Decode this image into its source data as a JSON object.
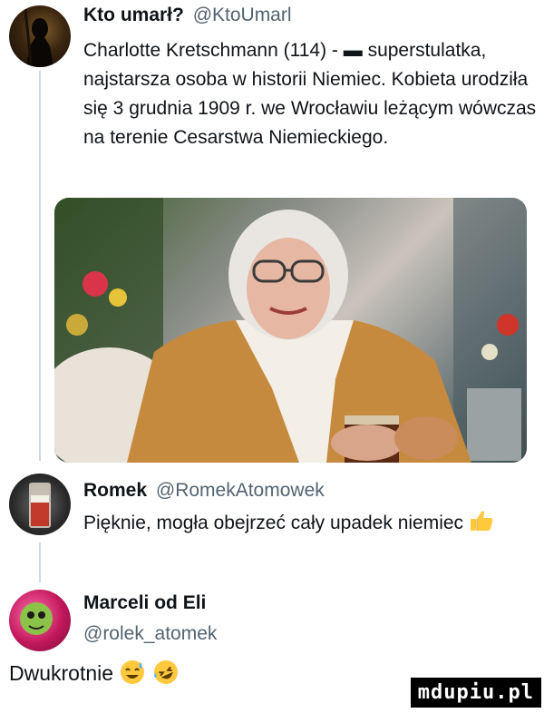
{
  "tweets": [
    {
      "name": "Kto umarł?",
      "handle": "@KtoUmarl",
      "text": "Charlotte Kretschmann (114) - ▬ superstulatka, najstarsza osoba w historii Niemiec. Kobieta urodziła się 3 grudnia 1909 r. we Wrocławiu leżącym wówczas na terenie Cesarstwa Niemieckiego.",
      "flag_colors": [
        "#000000",
        "#dd0000",
        "#ffce00"
      ]
    },
    {
      "name": "Romek",
      "handle": "@RomekAtomowek",
      "text": "Pięknie, mogła obejrzeć cały upadek niemiec",
      "emoji_icon": "thumbs-up-icon"
    },
    {
      "name": "Marceli od Eli",
      "handle": "@rolek_atomek"
    }
  ],
  "comment": {
    "text": "Dwukrotnie",
    "emoji_icons": [
      "sweat-smile-icon",
      "rofl-icon"
    ]
  },
  "watermark": "mdupiu.pl"
}
